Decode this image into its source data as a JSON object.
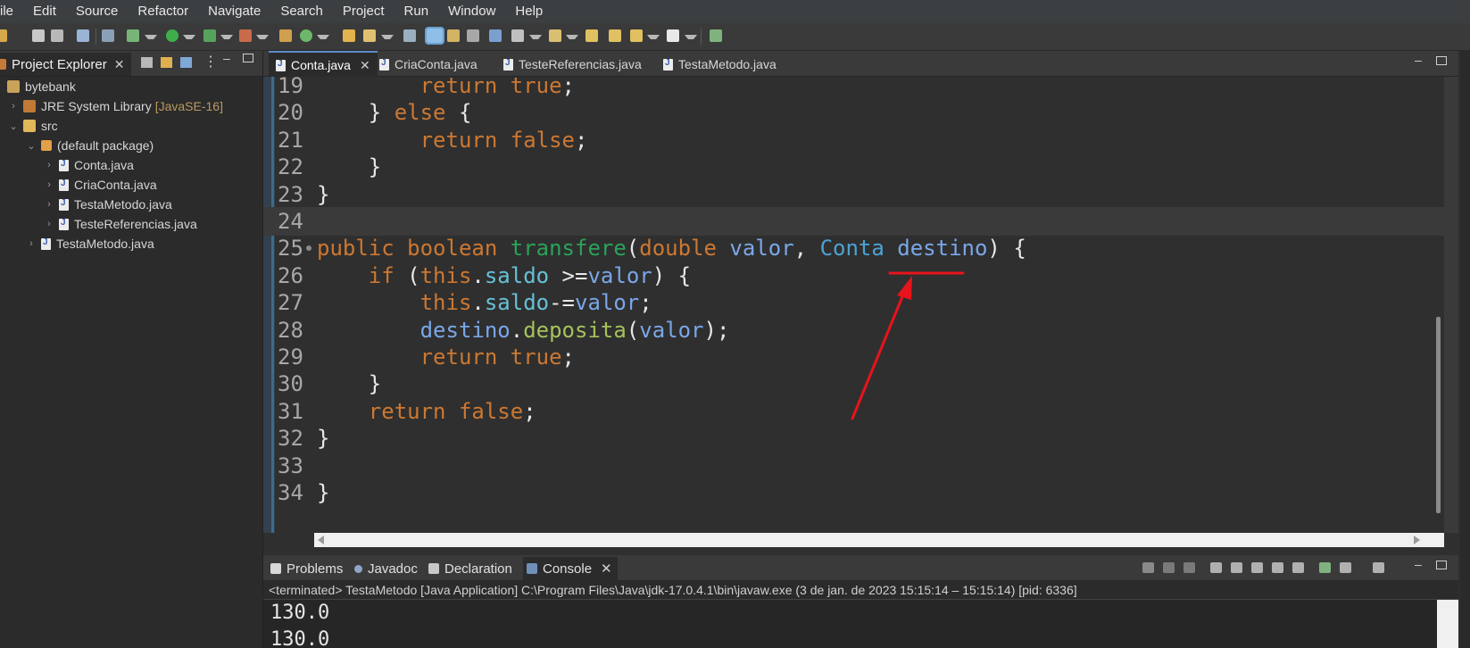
{
  "menu": [
    "ile",
    "Edit",
    "Source",
    "Refactor",
    "Navigate",
    "Search",
    "Project",
    "Run",
    "Window",
    "Help"
  ],
  "project_explorer": {
    "title": "Project Explorer",
    "close_glyph": "✕",
    "items": [
      {
        "label": "bytebank",
        "extra": "",
        "twisty": "",
        "icon": "project-icon"
      },
      {
        "label": "JRE System Library",
        "extra": "[JavaSE-16]",
        "twisty": "›",
        "icon": "library-icon"
      },
      {
        "label": "src",
        "extra": "",
        "twisty": "⌄",
        "icon": "source-folder-icon"
      },
      {
        "label": "(default package)",
        "extra": "",
        "twisty": "⌄",
        "icon": "package-icon"
      },
      {
        "label": "Conta.java",
        "extra": "",
        "twisty": "›",
        "icon": "java-file-icon"
      },
      {
        "label": "CriaConta.java",
        "extra": "",
        "twisty": "›",
        "icon": "java-file-icon"
      },
      {
        "label": "TestaMetodo.java",
        "extra": "",
        "twisty": "›",
        "icon": "java-file-icon"
      },
      {
        "label": "TesteReferencias.java",
        "extra": "",
        "twisty": "›",
        "icon": "java-file-icon"
      },
      {
        "label": "TestaMetodo.java",
        "extra": "",
        "twisty": "›",
        "icon": "java-file-icon"
      }
    ]
  },
  "editor": {
    "tabs": [
      {
        "label": "Conta.java",
        "active": true,
        "close": "✕"
      },
      {
        "label": "CriaConta.java",
        "active": false
      },
      {
        "label": "TesteReferencias.java",
        "active": false
      },
      {
        "label": "TestaMetodo.java",
        "active": false
      }
    ],
    "lines": [
      {
        "num": "19",
        "indent": "        ",
        "tokens": [
          [
            "kw",
            "return true"
          ],
          [
            "plain",
            ";"
          ]
        ]
      },
      {
        "num": "20",
        "indent": "    ",
        "tokens": [
          [
            "plain",
            "} "
          ],
          [
            "kw",
            "else"
          ],
          [
            "plain",
            " {"
          ]
        ]
      },
      {
        "num": "21",
        "indent": "        ",
        "tokens": [
          [
            "kw",
            "return false"
          ],
          [
            "plain",
            ";"
          ]
        ]
      },
      {
        "num": "22",
        "indent": "    ",
        "tokens": [
          [
            "plain",
            "}"
          ]
        ]
      },
      {
        "num": "23",
        "indent": "",
        "tokens": [
          [
            "plain",
            "}"
          ]
        ]
      },
      {
        "num": "24",
        "indent": "",
        "tokens": []
      },
      {
        "num": "25",
        "indent": "",
        "tokens": [
          [
            "kw",
            "public boolean "
          ],
          [
            "fn",
            "transfere"
          ],
          [
            "plain",
            "("
          ],
          [
            "kw",
            "double "
          ],
          [
            "var",
            "valor"
          ],
          [
            "plain",
            ", "
          ],
          [
            "type",
            "Conta"
          ],
          [
            "plain",
            " "
          ],
          [
            "var",
            "destino"
          ],
          [
            "plain",
            ") {"
          ]
        ]
      },
      {
        "num": "26",
        "indent": "    ",
        "tokens": [
          [
            "kw",
            "if"
          ],
          [
            "plain",
            " ("
          ],
          [
            "kw",
            "this"
          ],
          [
            "plain",
            "."
          ],
          [
            "fld",
            "saldo"
          ],
          [
            "plain",
            " >="
          ],
          [
            "var",
            "valor"
          ],
          [
            "plain",
            ") {"
          ]
        ]
      },
      {
        "num": "27",
        "indent": "        ",
        "tokens": [
          [
            "kw",
            "this"
          ],
          [
            "plain",
            "."
          ],
          [
            "fld",
            "saldo"
          ],
          [
            "plain",
            "-="
          ],
          [
            "var",
            "valor"
          ],
          [
            "plain",
            ";"
          ]
        ]
      },
      {
        "num": "28",
        "indent": "        ",
        "tokens": [
          [
            "var",
            "destino"
          ],
          [
            "plain",
            "."
          ],
          [
            "call",
            "deposita"
          ],
          [
            "plain",
            "("
          ],
          [
            "var",
            "valor"
          ],
          [
            "plain",
            ");"
          ]
        ]
      },
      {
        "num": "29",
        "indent": "        ",
        "tokens": [
          [
            "kw",
            "return true"
          ],
          [
            "plain",
            ";"
          ]
        ]
      },
      {
        "num": "30",
        "indent": "    ",
        "tokens": [
          [
            "plain",
            "}"
          ]
        ]
      },
      {
        "num": "31",
        "indent": "    ",
        "tokens": [
          [
            "kw",
            "return false"
          ],
          [
            "plain",
            ";"
          ]
        ]
      },
      {
        "num": "32",
        "indent": "",
        "tokens": [
          [
            "plain",
            "}"
          ]
        ]
      },
      {
        "num": "33",
        "indent": "",
        "tokens": []
      },
      {
        "num": "34",
        "indent": "",
        "tokens": [
          [
            "plain",
            "}"
          ]
        ]
      }
    ]
  },
  "bottom_panel": {
    "tabs": [
      {
        "label": "Problems",
        "icon": "problems-icon"
      },
      {
        "label": "Javadoc",
        "icon": "javadoc-icon"
      },
      {
        "label": "Declaration",
        "icon": "declaration-icon"
      },
      {
        "label": "Console",
        "icon": "console-icon",
        "active": true,
        "close": "✕"
      }
    ],
    "status": "<terminated> TestaMetodo [Java Application] C:\\Program Files\\Java\\jdk-17.0.4.1\\bin\\javaw.exe  (3 de jan. de 2023 15:15:14 – 15:15:14) [pid: 6336]",
    "output": [
      "130.0",
      "130.0"
    ]
  },
  "colors": {
    "annotation": "#e8131b",
    "keyword": "#cc7832",
    "method": "#29a35a",
    "field": "#66c1d6",
    "variable": "#7aa7e8",
    "type": "#4da3d4"
  }
}
